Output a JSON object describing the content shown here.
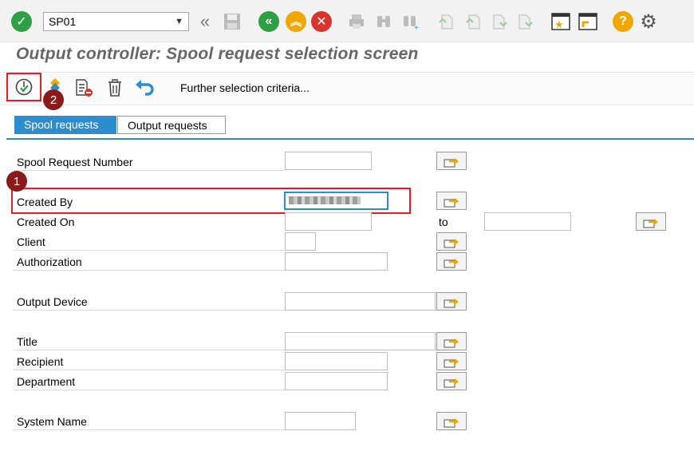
{
  "toolbar": {
    "command_field_value": "SP01"
  },
  "screen_title": "Output controller: Spool request selection screen",
  "app_toolbar": {
    "further_selection_label": "Further selection criteria..."
  },
  "tabs": [
    {
      "label": "Spool requests",
      "active": true
    },
    {
      "label": "Output requests",
      "active": false
    }
  ],
  "fields": {
    "spool_request_number": "Spool Request Number",
    "created_by": "Created By",
    "created_on": "Created On",
    "to_label": "to",
    "client": "Client",
    "authorization": "Authorization",
    "output_device": "Output Device",
    "title": "Title",
    "recipient": "Recipient",
    "department": "Department",
    "system_name": "System Name"
  },
  "annotations": {
    "marker_1": "1",
    "marker_2": "2"
  },
  "colors": {
    "accent": "#2d8ecf",
    "highlight": "#e02020",
    "marker": "#8b1a1a",
    "green": "#2ea043",
    "orange": "#f0a800",
    "red": "#d9342b"
  }
}
